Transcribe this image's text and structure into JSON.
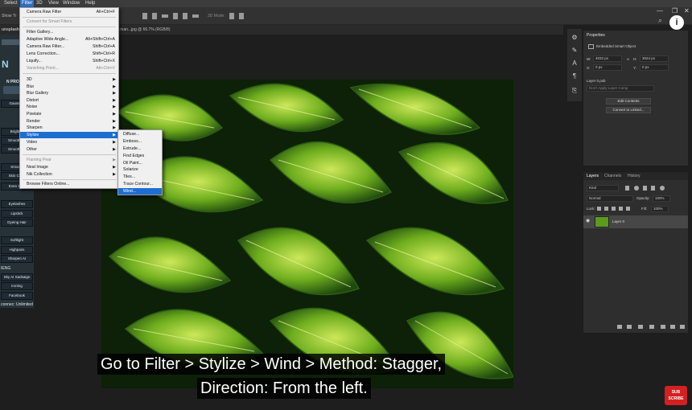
{
  "menubar": {
    "items": [
      "Select",
      "Filter",
      "3D",
      "View",
      "Window",
      "Help"
    ]
  },
  "options": {
    "show_label": "Show Tr",
    "mode_label": "3D Mode:"
  },
  "doc_tab": {
    "left": "unsplash",
    "title": "...man...jpg @ 66.7% (RGB/8)"
  },
  "filter_menu": {
    "items": [
      {
        "label": "Camera Raw Filter",
        "shortcut": "Alt+Ctrl+F"
      },
      {
        "label": "Convert for Smart Filters",
        "disabled": true
      },
      {
        "label": "Filter Gallery..."
      },
      {
        "label": "Adaptive Wide Angle...",
        "shortcut": "Alt+Shift+Ctrl+A"
      },
      {
        "label": "Camera Raw Filter...",
        "shortcut": "Shift+Ctrl+A"
      },
      {
        "label": "Lens Correction...",
        "shortcut": "Shift+Ctrl+R"
      },
      {
        "label": "Liquify...",
        "shortcut": "Shift+Ctrl+X"
      },
      {
        "label": "Vanishing Point...",
        "shortcut": "Alt+Ctrl+V",
        "disabled": true
      },
      {
        "label": "3D"
      },
      {
        "label": "Blur"
      },
      {
        "label": "Blur Gallery"
      },
      {
        "label": "Distort"
      },
      {
        "label": "Noise"
      },
      {
        "label": "Pixelate"
      },
      {
        "label": "Render"
      },
      {
        "label": "Sharpen"
      },
      {
        "label": "Stylize"
      },
      {
        "label": "Video"
      },
      {
        "label": "Other"
      },
      {
        "label": "Flaming Pear",
        "disabled": true
      },
      {
        "label": "Neat Image"
      },
      {
        "label": "Nik Collection"
      },
      {
        "label": "Browse Filters Online..."
      }
    ]
  },
  "stylize_menu": {
    "items": [
      "Diffuse...",
      "Emboss...",
      "Extrude...",
      "Find Edges",
      "Oil Paint...",
      "Solarize",
      "Tiles...",
      "Trace Contour...",
      "Wind..."
    ]
  },
  "left_panel": {
    "logo": "N",
    "section_title": "N PROCES",
    "items": [
      "Gaussian",
      "Brighten",
      "Smooth Sk",
      "Smooth Sk",
      "Smooth",
      "Skin Color",
      "Even Skin",
      "Eyelashes",
      "Lipstick",
      "Dyeing Hair",
      "Softlight",
      "Highpass",
      "Sharpen AI",
      "Sky AI Sadsaign",
      "Ironing",
      "Facebook"
    ],
    "extra": [
      "IENG",
      "connec: Unlimited"
    ]
  },
  "properties": {
    "title": "Properties",
    "object_type": "Embedded Smart Object",
    "w_label": "W:",
    "w_value": "4032 px",
    "h_label": "H:",
    "h_value": "3024 px",
    "x_label": "X:",
    "x_value": "0 px",
    "y_label": "Y:",
    "y_value": "0 px",
    "layer_name": "Layer 0.psb",
    "comp_placeholder": "Don't Apply Layer Comp",
    "edit_btn": "Edit Contents",
    "convert_btn": "Convert to Linked..."
  },
  "layers": {
    "tabs": [
      "Layers",
      "Channels",
      "History"
    ],
    "kind": "Kind",
    "blend": "Normal",
    "opacity_label": "Opacity:",
    "opacity": "100%",
    "lock_label": "Lock:",
    "fill_label": "Fill:",
    "fill": "100%",
    "layer_name": "Layer 0"
  },
  "subtitle": {
    "line1": "Go to Filter > Stylize > Wind > Method: Stagger,",
    "line2": "Direction: From the left."
  },
  "badge": {
    "top": "SUB",
    "bottom": "SCRIBE"
  },
  "colors": {
    "accent": "#1d6ed1",
    "leaf": "#6fae1e",
    "panel": "#2e2e2e"
  }
}
